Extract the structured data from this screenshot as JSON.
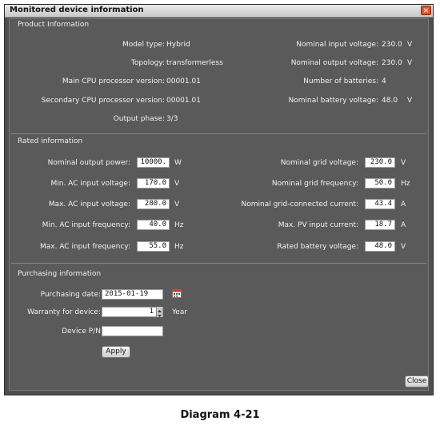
{
  "window": {
    "title": "Monitored device information",
    "close_glyph": "×"
  },
  "product": {
    "header": "Product Information",
    "model_type_label": "Model type:",
    "model_type": "Hybrid",
    "topology_label": "Topology:",
    "topology": "transformerless",
    "main_cpu_label": "Main CPU processor version:",
    "main_cpu": "00001.01",
    "sec_cpu_label": "Secondary CPU processor version:",
    "sec_cpu": "00001.01",
    "output_phase_label": "Output phase:",
    "output_phase": "3/3",
    "nom_in_v_label": "Nominal input voltage:",
    "nom_in_v": "230.0",
    "nom_in_v_unit": "V",
    "nom_out_v_label": "Nominal output voltage:",
    "nom_out_v": "230.0",
    "nom_out_v_unit": "V",
    "num_batt_label": "Number of batteries:",
    "num_batt": "4",
    "nom_batt_v_label": "Nominal battery voltage:",
    "nom_batt_v": "48.0",
    "nom_batt_v_unit": "V"
  },
  "rated": {
    "header": "Rated information",
    "left": [
      {
        "label": "Nominal output power:",
        "value": "10000.(",
        "unit": "W"
      },
      {
        "label": "Min. AC input voltage:",
        "value": "170.0",
        "unit": "V"
      },
      {
        "label": "Max. AC input voltage:",
        "value": "280.0",
        "unit": "V"
      },
      {
        "label": "Min. AC input frequency:",
        "value": "40.0",
        "unit": "Hz"
      },
      {
        "label": "Max. AC input frequency:",
        "value": "55.0",
        "unit": "Hz"
      }
    ],
    "right": [
      {
        "label": "Nominal grid voltage:",
        "value": "230.0",
        "unit": "V"
      },
      {
        "label": "Nominal grid frequency:",
        "value": "50.0",
        "unit": "Hz"
      },
      {
        "label": "Nominal grid-connected current:",
        "value": "43.4",
        "unit": "A"
      },
      {
        "label": "Max. PV input current:",
        "value": "18.7",
        "unit": "A"
      },
      {
        "label": "Rated battery voltage:",
        "value": "48.0",
        "unit": "V"
      }
    ]
  },
  "purchasing": {
    "header": "Purchasing information",
    "date_label": "Purchasing date:",
    "date": "2015-01-19",
    "warranty_label": "Warranty for device:",
    "warranty": "1",
    "warranty_unit": "Year",
    "pn_label": "Device P/N",
    "pn": "",
    "apply_label": "Apply"
  },
  "footer": {
    "close_label": "Close"
  },
  "caption": "Diagram 4-21"
}
